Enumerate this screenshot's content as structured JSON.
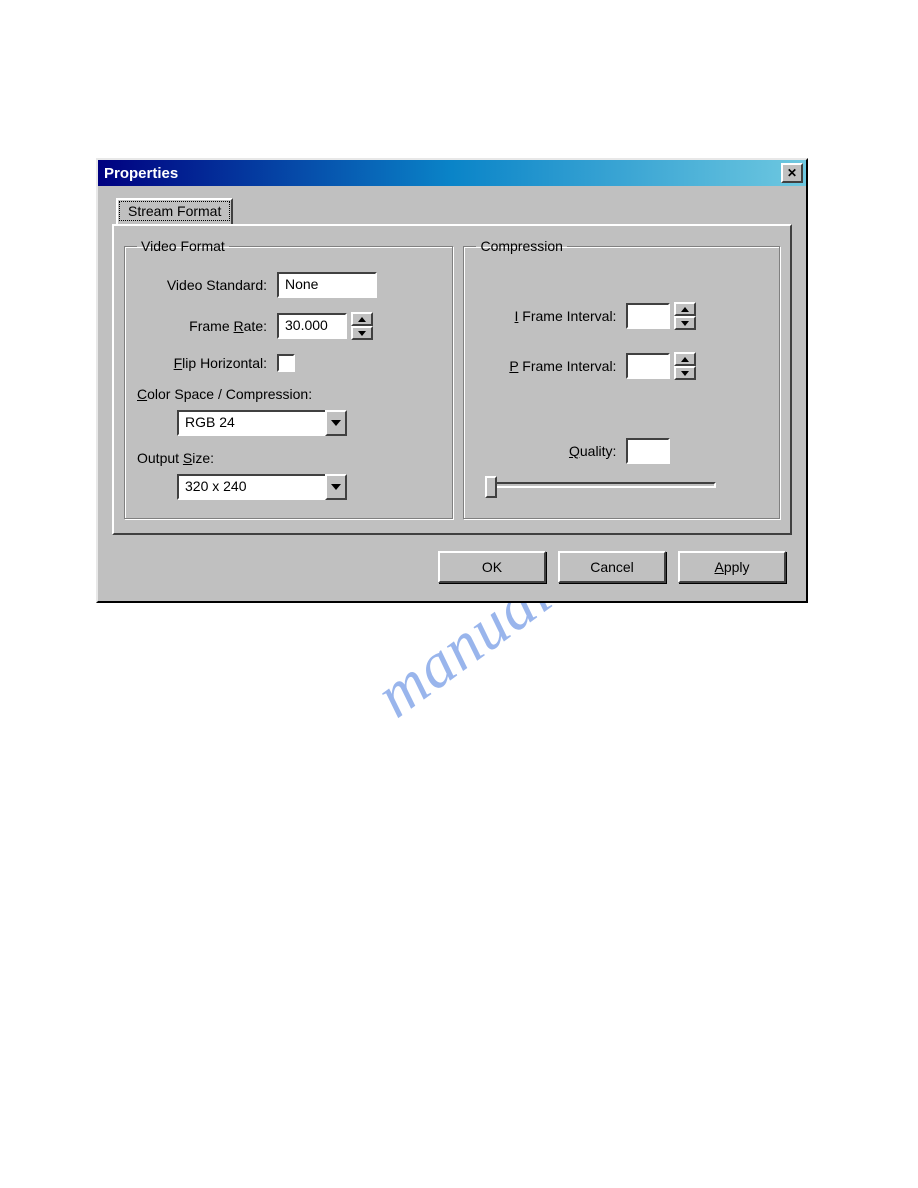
{
  "watermark": "manualshive.com",
  "dialog": {
    "title": "Properties",
    "tab_label": "Stream Format",
    "video_format": {
      "legend": "Video Format",
      "video_standard_label": "Video Standard:",
      "video_standard_value": "None",
      "frame_rate_label_pre": "Frame ",
      "frame_rate_label_hot": "R",
      "frame_rate_label_post": "ate:",
      "frame_rate_value": "30.000",
      "flip_label_hot": "F",
      "flip_label_post": "lip Horizontal:",
      "color_space_label_hot": "C",
      "color_space_label_post": "olor Space / Compression:",
      "color_space_value": "RGB 24",
      "output_size_label_pre": "Output ",
      "output_size_label_hot": "S",
      "output_size_label_post": "ize:",
      "output_size_value": "320 x 240"
    },
    "compression": {
      "legend": "Compression",
      "i_frame_label_hot": "I",
      "i_frame_label_post": " Frame Interval:",
      "i_frame_value": "",
      "p_frame_label_hot": "P",
      "p_frame_label_post": " Frame Interval:",
      "p_frame_value": "",
      "quality_label_hot": "Q",
      "quality_label_post": "uality:",
      "quality_value": ""
    },
    "buttons": {
      "ok": "OK",
      "cancel": "Cancel",
      "apply_hot": "A",
      "apply_post": "pply"
    }
  }
}
